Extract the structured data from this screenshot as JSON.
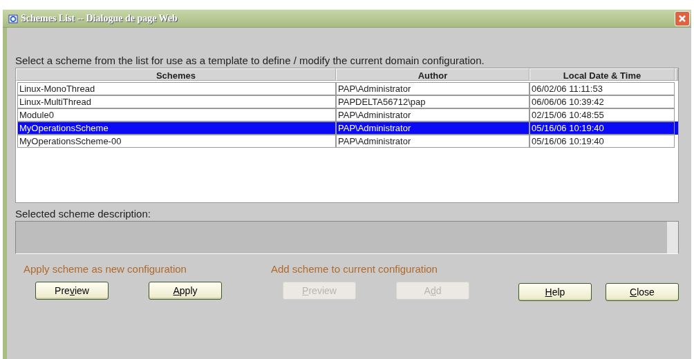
{
  "window": {
    "title": "Schemes List -- Dialogue de page Web"
  },
  "instructions": "Select a scheme from the list for use as a template to define / modify the current domain configuration.",
  "table": {
    "columns": [
      "Schemes",
      "Author",
      "Local Date & Time"
    ],
    "rows": [
      {
        "cells": [
          "Linux-MonoThread",
          "PAP\\Administrator",
          "06/02/06 11:11:53"
        ],
        "selected": false
      },
      {
        "cells": [
          "Linux-MultiThread",
          "PAPDELTA56712\\pap",
          "06/06/06 10:39:42"
        ],
        "selected": false
      },
      {
        "cells": [
          "Module0",
          "PAP\\Administrator",
          "02/15/06 10:48:55"
        ],
        "selected": false
      },
      {
        "cells": [
          "MyOperationsScheme",
          "PAP\\Administrator",
          "05/16/06 10:19:40"
        ],
        "selected": true
      },
      {
        "cells": [
          "MyOperationsScheme-00",
          "PAP\\Administrator",
          "05/16/06 10:19:40"
        ],
        "selected": false
      }
    ]
  },
  "description": {
    "label": "Selected scheme description:"
  },
  "groups": [
    {
      "title": "Apply scheme as new configuration",
      "buttons": [
        {
          "parts": [
            {
              "text": "Pre",
              "underlined": false
            },
            {
              "text": "v",
              "underlined": true
            },
            {
              "text": "iew",
              "underlined": false
            }
          ],
          "disabled": false
        },
        {
          "parts": [
            {
              "text": "A",
              "underlined": true
            },
            {
              "text": "pply",
              "underlined": false
            }
          ],
          "disabled": false
        }
      ]
    },
    {
      "title": "Add scheme to current configuration",
      "buttons": [
        {
          "parts": [
            {
              "text": "P",
              "underlined": true
            },
            {
              "text": "review",
              "underlined": false
            }
          ],
          "disabled": true
        },
        {
          "parts": [
            {
              "text": "A",
              "underlined": false
            },
            {
              "text": "d",
              "underlined": true
            },
            {
              "text": "d",
              "underlined": false
            }
          ],
          "disabled": true
        }
      ]
    }
  ],
  "buttons": [
    {
      "parts": [
        {
          "text": "H",
          "underlined": true
        },
        {
          "text": "elp",
          "underlined": false
        }
      ],
      "disabled": false
    },
    {
      "parts": [
        {
          "text": "C",
          "underlined": true
        },
        {
          "text": "lose",
          "underlined": false
        }
      ],
      "disabled": false
    }
  ]
}
